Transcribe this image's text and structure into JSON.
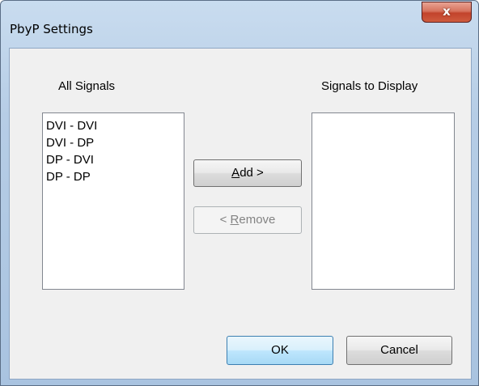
{
  "window": {
    "title": "PbyP Settings",
    "close_glyph": "x"
  },
  "all_signals": {
    "label": "All Signals",
    "items": [
      "DVI - DVI",
      "DVI - DP",
      "DP - DVI",
      "DP - DP"
    ]
  },
  "display_signals": {
    "label": "Signals to Display",
    "items": []
  },
  "buttons": {
    "add": {
      "mnemonic": "A",
      "rest": "dd >",
      "enabled": true
    },
    "remove": {
      "prefix": "< ",
      "mnemonic": "R",
      "rest": "emove",
      "enabled": false
    },
    "ok": "OK",
    "cancel": "Cancel"
  }
}
